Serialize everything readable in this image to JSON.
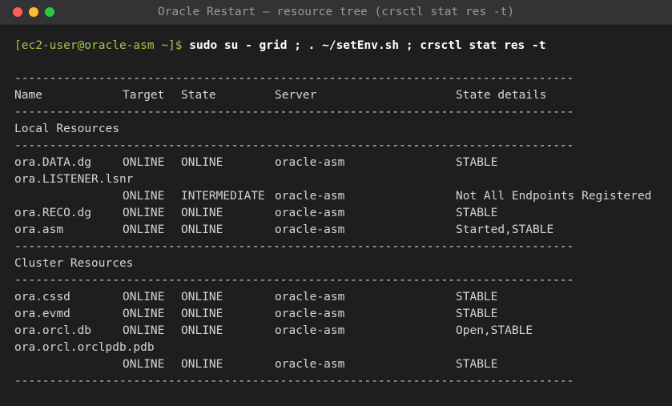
{
  "window": {
    "title": "Oracle Restart — resource tree (crsctl stat res -t)",
    "traffic_lights": [
      "close",
      "minimize",
      "zoom"
    ],
    "colors": {
      "close": "#ff5f57",
      "minimize": "#febc2e",
      "zoom": "#28c840",
      "background": "#1e1e1e",
      "prompt": "#9ec94a"
    }
  },
  "terminal": {
    "prompt": "[ec2-user@oracle-asm ~]$",
    "command": "sudo su - grid ; . ~/setEnv.sh ; crsctl stat res -t",
    "separator": "--------------------------------------------------------------------------------",
    "headers": [
      "Name",
      "Target",
      "State",
      "Server",
      "State details"
    ],
    "sections": [
      {
        "title": "Local Resources",
        "rows": [
          {
            "name": "ora.DATA.dg",
            "target": "ONLINE",
            "state": "ONLINE",
            "server": "oracle-asm",
            "details": "STABLE"
          },
          {
            "name": "ora.LISTENER.lsnr",
            "target": "ONLINE",
            "state": "INTERMEDIATE",
            "server": "oracle-asm",
            "details": "Not All Endpoints Registered"
          },
          {
            "name": "ora.RECO.dg",
            "target": "ONLINE",
            "state": "ONLINE",
            "server": "oracle-asm",
            "details": "STABLE"
          },
          {
            "name": "ora.asm",
            "target": "ONLINE",
            "state": "ONLINE",
            "server": "oracle-asm",
            "details": "Started,STABLE"
          }
        ]
      },
      {
        "title": "Cluster Resources",
        "rows": [
          {
            "name": "ora.cssd",
            "target": "ONLINE",
            "state": "ONLINE",
            "server": "oracle-asm",
            "details": "STABLE"
          },
          {
            "name": "ora.evmd",
            "target": "ONLINE",
            "state": "ONLINE",
            "server": "oracle-asm",
            "details": "STABLE"
          },
          {
            "name": "ora.orcl.db",
            "target": "ONLINE",
            "state": "ONLINE",
            "server": "oracle-asm",
            "details": "Open,STABLE"
          },
          {
            "name": "ora.orcl.orclpdb.pdb",
            "target": "ONLINE",
            "state": "ONLINE",
            "server": "oracle-asm",
            "details": "STABLE"
          }
        ]
      }
    ]
  }
}
